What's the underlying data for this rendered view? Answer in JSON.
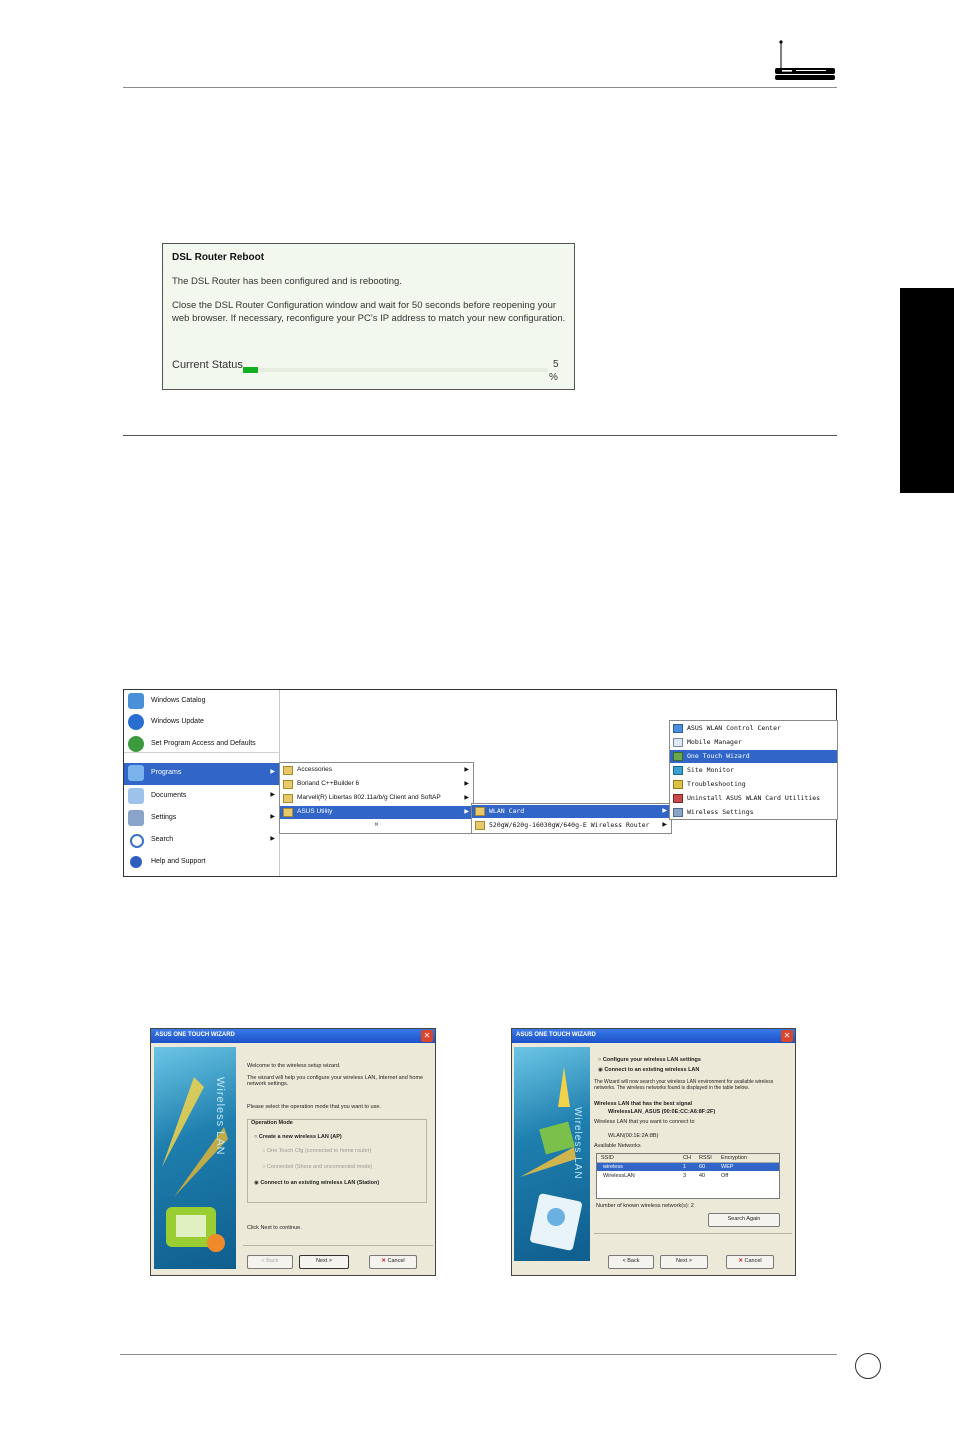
{
  "reboot": {
    "title": "DSL Router Reboot",
    "message": "The DSL Router has been configured and is rebooting.",
    "instructions": "Close the DSL Router Configuration window and wait for 50 seconds before reopening your web browser.  If necessary, reconfigure your PC's IP address to match your new configuration.",
    "status_label": "Current Status",
    "progress_value": "5",
    "progress_unit": "%",
    "progress_fraction": 0.05,
    "fill_color": "#10b020"
  },
  "start_menu": {
    "pinned": [
      "Windows Catalog",
      "Windows Update",
      "Set Program Access and Defaults"
    ],
    "items": [
      "Programs",
      "Documents",
      "Settings",
      "Search",
      "Help and Support"
    ],
    "programs_submenu": [
      "Accessories",
      "Borland C++Builder 6",
      "Marvell(R) Libertas 802.11a/b/g Client and SoftAP",
      "ASUS Utility"
    ],
    "programs_more": "»",
    "asus_submenu": [
      "WLAN Card",
      "520gW/620g-16030gW/640g-E Wireless Router"
    ],
    "wlan_submenu": [
      "ASUS WLAN Control Center",
      "Mobile Manager",
      "One Touch Wizard",
      "Site Monitor",
      "Troubleshooting",
      "Uninstall ASUS WLAN Card Utilities",
      "Wireless Settings"
    ]
  },
  "wizard_left": {
    "title": "ASUS ONE TOUCH WIZARD",
    "side_text": "Wireless LAN",
    "intro": "Welcome to the wireless setup wizard.",
    "desc": "The wizard will help you configure your wireless LAN, Internet and home network settings.",
    "prompt": "Please select the operation mode that you want to use.",
    "group": "Operation Mode",
    "options": [
      "Create a new wireless LAN (AP)",
      "One Touch Cfg (connected to home router)",
      "Connected (Share and unconnected mode)",
      "Connect to an existing wireless LAN (Station)"
    ],
    "hint": "Click Next to continue.",
    "back": "< Back",
    "next": "Next >",
    "cancel": "Cancel"
  },
  "wizard_right": {
    "title": "ASUS ONE TOUCH WIZARD",
    "side_text": "Wireless LAN",
    "options": [
      "Configure your wireless LAN settings",
      "Connect to an existing wireless LAN"
    ],
    "desc": "The Wizard will now search your wireless LAN environment for available wireless networks. The wireless networks found is displayed in the table below.",
    "best_label": "Wireless LAN that has the best signal",
    "best_value": "WirelessLAN_ASUS (00:0E:CC:A6:8F:2F)",
    "connect_label": "Wireless LAN that you want to connect to",
    "connect_value": "WLAN(00:1E:2A:8B)",
    "available_label": "Available Networks",
    "columns": [
      "SSID",
      "CH",
      "RSSI",
      "Encryption"
    ],
    "rows": [
      [
        "wireless",
        "1",
        "60",
        "WEP"
      ],
      [
        "WirelessLAN",
        "3",
        "40",
        "Off"
      ]
    ],
    "count_label": "Number of known wireless network(s): 2",
    "search": "Search Again",
    "back": "< Back",
    "next": "Next >",
    "cancel": "Cancel"
  },
  "colors": {
    "side_tab": "#000000",
    "menu_highlight": "#3166c8",
    "titlebar": "#1c50c8"
  }
}
